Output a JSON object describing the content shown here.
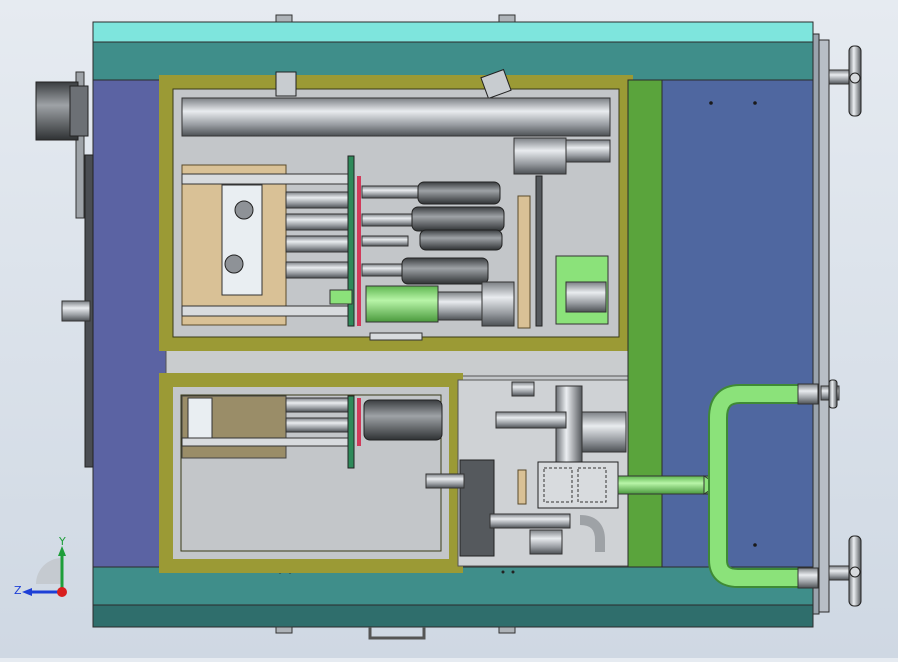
{
  "view": {
    "type": "cad-assembly-side-section",
    "background": "#dde4ec"
  },
  "colors": {
    "frame_cyan": "#7ee5dd",
    "frame_teal": "#3f8e8a",
    "frame_dark_teal": "#2f6e6c",
    "side_panel_blue": "#5b63a3",
    "right_panel_blue": "#4f67a0",
    "olive_frame": "#9b9a35",
    "green_post": "#5aa43c",
    "pipe_green": "#8be27a",
    "bronze": "#d9c196",
    "metal_grey": "#a9adb2",
    "dark_metal": "#55595d",
    "interior_grey": "#c3c6c9",
    "red_guide": "#d03a5a",
    "green_guide": "#2e8a5a"
  },
  "axis_triad": {
    "y_label": "Y",
    "z_label": "Z",
    "y_color": "#1e9e3a",
    "z_color": "#1d3fd6",
    "origin_color": "#d81e1e"
  },
  "icons": {
    "axis_triad": "coordinate-axes-icon",
    "handwheels": "handwheel-icon"
  }
}
